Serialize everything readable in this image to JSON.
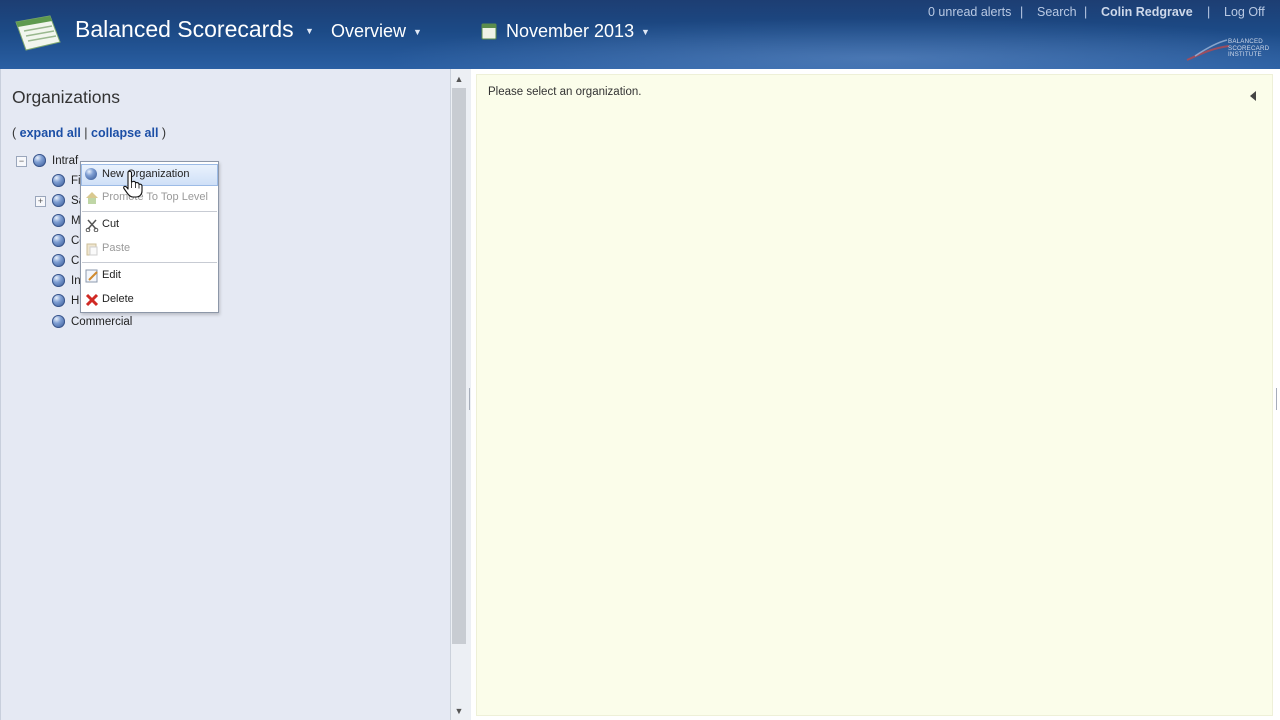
{
  "header": {
    "app_title": "Balanced Scorecards",
    "nav_label": "Overview",
    "period_label": "November 2013",
    "alerts_label": "0 unread alerts",
    "search_label": "Search",
    "user_name": "Colin Redgrave",
    "logoff_label": "Log Off",
    "separator": "|",
    "bsi_logo_lines": [
      "BALANCED",
      "SCORECARD",
      "INSTITUTE"
    ]
  },
  "left_panel": {
    "title": "Organizations",
    "expand_all": "expand all",
    "collapse_all": "collapse all",
    "paren_open": "(",
    "paren_close": ")",
    "link_sep": "|",
    "tree": {
      "root_label": "Intraf",
      "toggle_root": "−",
      "toggle_child": "+",
      "children": [
        "Fi",
        "Sa",
        "M",
        "Co",
        "Cr",
        "In",
        "H",
        "Commercial"
      ]
    }
  },
  "context_menu": {
    "items": [
      {
        "label": "New Organization",
        "icon": "organization-orb-icon",
        "state": "active"
      },
      {
        "label": "Promote To Top Level",
        "icon": "promote-house-icon",
        "state": "disabled"
      },
      {
        "label": "Cut",
        "icon": "scissors-icon",
        "state": "enabled"
      },
      {
        "label": "Paste",
        "icon": "paste-clipboard-icon",
        "state": "disabled"
      },
      {
        "label": "Edit",
        "icon": "edit-pencil-icon",
        "state": "enabled"
      },
      {
        "label": "Delete",
        "icon": "delete-x-icon",
        "state": "enabled"
      }
    ]
  },
  "right_panel": {
    "message": "Please select an organization."
  },
  "colors": {
    "header_dark": "#1d3e73",
    "link_blue": "#1c4fa6",
    "content_bg": "#fbfdea",
    "left_bg": "#e5e9f3"
  }
}
